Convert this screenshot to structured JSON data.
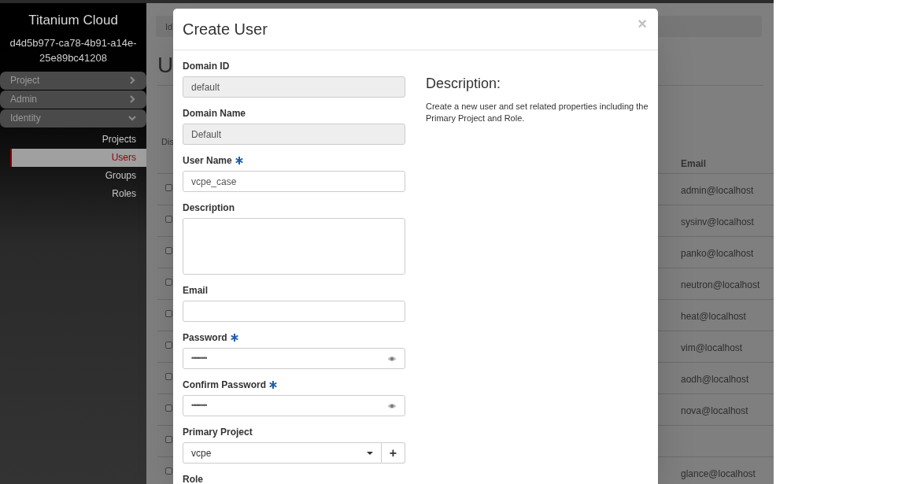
{
  "sidebar": {
    "brand": "Titanium Cloud",
    "region": "d4d5b977-ca78-4b91-a14e-25e89bc41208",
    "panels": [
      {
        "label": "Project",
        "expanded": false
      },
      {
        "label": "Admin",
        "expanded": false
      },
      {
        "label": "Identity",
        "expanded": true
      }
    ],
    "items": [
      {
        "label": "Projects",
        "selected": false
      },
      {
        "label": "Users",
        "selected": true
      },
      {
        "label": "Groups",
        "selected": false
      },
      {
        "label": "Roles",
        "selected": false
      }
    ]
  },
  "background": {
    "breadcrumb": "Id",
    "page_title": "U",
    "filter_label": "Dis",
    "email_header": "Email",
    "rows": [
      {
        "email": "admin@localhost",
        "checked": false
      },
      {
        "email": "sysinv@localhost",
        "checked": false
      },
      {
        "email": "panko@localhost",
        "checked": false
      },
      {
        "email": "neutron@localhost",
        "checked": false
      },
      {
        "email": "heat@localhost",
        "checked": false
      },
      {
        "email": "vim@localhost",
        "checked": false
      },
      {
        "email": "aodh@localhost",
        "checked": false
      },
      {
        "email": "nova@localhost",
        "checked": false
      },
      {
        "checked": false
      },
      {
        "email": "glance@localhost",
        "checked": false
      }
    ]
  },
  "modal": {
    "title": "Create User",
    "close": "×",
    "fields": [
      {
        "kind": "text",
        "label": "Domain ID",
        "value": "default",
        "disabled": true,
        "required": false
      },
      {
        "kind": "text",
        "label": "Domain Name",
        "value": "Default",
        "disabled": true,
        "required": false
      },
      {
        "kind": "text",
        "label": "User Name",
        "value": "vcpe_case",
        "disabled": false,
        "required": true
      },
      {
        "kind": "textarea",
        "label": "Description",
        "disabled": false,
        "required": false
      },
      {
        "kind": "text",
        "label": "Email",
        "disabled": false,
        "required": false
      },
      {
        "kind": "password",
        "label": "Password",
        "value": "•••••••••",
        "disabled": false,
        "required": true
      },
      {
        "kind": "password",
        "label": "Confirm Password",
        "value": "•••••••••",
        "disabled": false,
        "required": true
      },
      {
        "kind": "select",
        "label": "Primary Project",
        "value": "vcpe",
        "disabled": false,
        "required": false,
        "add": "+"
      },
      {
        "kind": "label",
        "label": "Role"
      }
    ],
    "description_title": "Description:",
    "description_text": "Create a new user and set related properties including the Primary Project and Role."
  }
}
